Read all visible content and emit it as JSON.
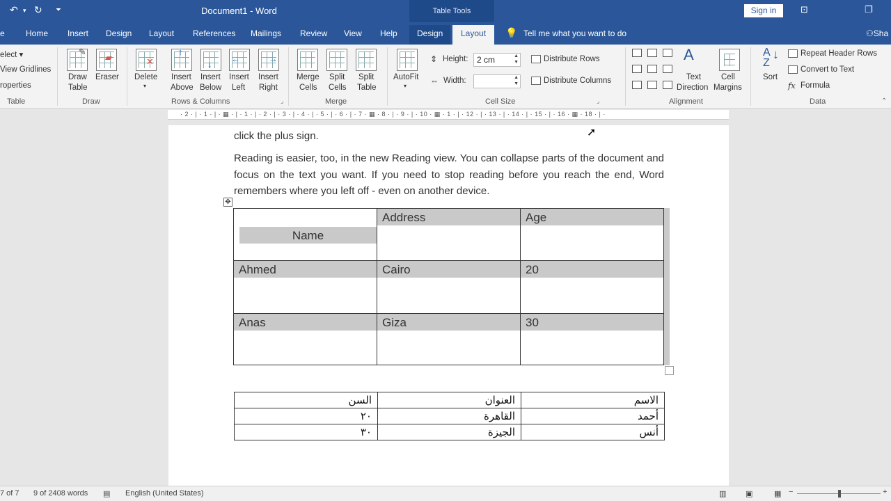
{
  "titlebar": {
    "doc_title": "Document1  -  Word",
    "table_tools": "Table Tools",
    "sign_in": "Sign in"
  },
  "menu": {
    "file_partial": "e",
    "tabs": [
      "Home",
      "Insert",
      "Design",
      "Layout",
      "References",
      "Mailings",
      "Review",
      "View",
      "Help"
    ],
    "ctx_design": "Design",
    "ctx_layout": "Layout",
    "tell_me": "Tell me what you want to do",
    "share_partial": "Sha"
  },
  "ribbon": {
    "table_group": {
      "select": "elect",
      "view_gridlines": "View Gridlines",
      "properties": "roperties",
      "caption": "Table"
    },
    "draw_group": {
      "draw_table_1": "Draw",
      "draw_table_2": "Table",
      "eraser": "Eraser",
      "caption": "Draw"
    },
    "rows_cols_group": {
      "delete": "Delete",
      "insert_above_1": "Insert",
      "insert_above_2": "Above",
      "insert_below_1": "Insert",
      "insert_below_2": "Below",
      "insert_left_1": "Insert",
      "insert_left_2": "Left",
      "insert_right_1": "Insert",
      "insert_right_2": "Right",
      "caption": "Rows & Columns"
    },
    "merge_group": {
      "merge_1": "Merge",
      "merge_2": "Cells",
      "split_cells_1": "Split",
      "split_cells_2": "Cells",
      "split_table_1": "Split",
      "split_table_2": "Table",
      "caption": "Merge"
    },
    "cell_size_group": {
      "autofit": "AutoFit",
      "height_label": "Height:",
      "height_value": "2 cm",
      "width_label": "Width:",
      "width_value": "",
      "distribute_rows": "Distribute Rows",
      "distribute_columns": "Distribute Columns",
      "caption": "Cell Size"
    },
    "alignment_group": {
      "text_direction_1": "Text",
      "text_direction_2": "Direction",
      "cell_margins_1": "Cell",
      "cell_margins_2": "Margins",
      "caption": "Alignment"
    },
    "data_group": {
      "sort": "Sort",
      "repeat_header_rows": "Repeat Header Rows",
      "convert_to_text": "Convert to Text",
      "formula": "Formula",
      "caption": "Data"
    }
  },
  "ruler": {
    "numbers": "· 2 · | · 1 · | · ▦ · | · 1 · | · 2 · | · 3 · | · 4 · | · 5 · | · 6 · | · 7 · ▦ · 8 · | · 9 · | · 10 · ▦ · 1 · | · 12 · | · 13 · | · 14 · | · 15 · | · 16 · ▦ · 18 · | ·"
  },
  "document": {
    "para1": "click the plus sign.",
    "para2": "Reading is easier, too, in the new Reading view. You can collapse parts of the document and focus on the text you want. If you need to stop reading before you reach the end, Word remembers where you left off - even on another device.",
    "table_headers": [
      "Name",
      "Address",
      "Age"
    ],
    "table_rows": [
      [
        "Ahmed",
        "Cairo",
        "20"
      ],
      [
        "Anas",
        "Giza",
        "30"
      ]
    ],
    "arabic_table": [
      [
        "الاسم",
        "العنوان",
        "السن"
      ],
      [
        "أحمد",
        "القاهرة",
        "٢٠"
      ],
      [
        "أنس",
        "الجيزة",
        "٣٠"
      ]
    ]
  },
  "status": {
    "page": "7 of 7",
    "words": "9 of 2408 words",
    "language": "English (United States)"
  }
}
